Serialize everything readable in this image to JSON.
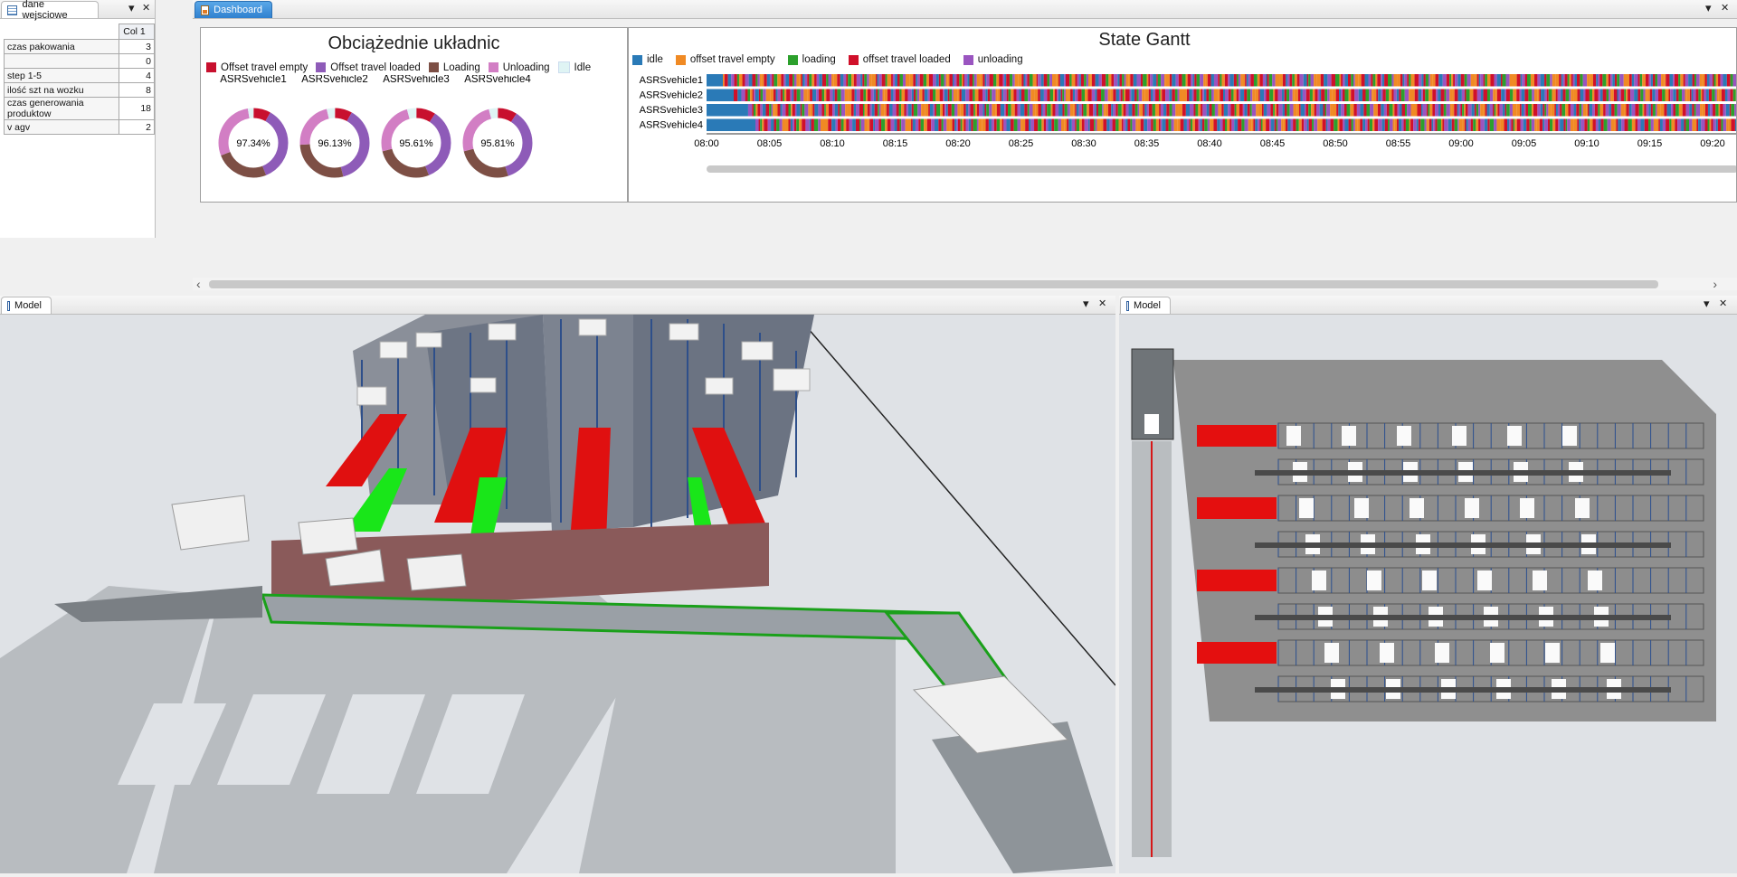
{
  "left_pane": {
    "tab_label": "dane wejsciowe",
    "column_header": "Col 1",
    "rows": [
      {
        "label": "czas pakowania",
        "value": "3"
      },
      {
        "label": "",
        "value": "0"
      },
      {
        "label": "step 1-5",
        "value": "4"
      },
      {
        "label": "ilość szt na wozku",
        "value": "8"
      },
      {
        "label": "czas generowania produktow",
        "value": "18"
      },
      {
        "label": "v agv",
        "value": "2"
      }
    ]
  },
  "dashboard": {
    "tab_label": "Dashboard",
    "utilization": {
      "title": "Obciążednie układnic",
      "legend": [
        {
          "label": "Offset travel empty",
          "color": "#c8102e"
        },
        {
          "label": "Offset travel loaded",
          "color": "#8e5bb8"
        },
        {
          "label": "Loading",
          "color": "#7d4f45"
        },
        {
          "label": "Unloading",
          "color": "#d27ec4"
        },
        {
          "label": "Idle",
          "color": "#dff4f4"
        }
      ]
    },
    "gantt": {
      "title": "State Gantt",
      "legend": [
        {
          "label": "idle",
          "color": "#2a7ab7"
        },
        {
          "label": "offset travel empty",
          "color": "#f08a24"
        },
        {
          "label": "loading",
          "color": "#2ca02c"
        },
        {
          "label": "offset travel loaded",
          "color": "#d0102a"
        },
        {
          "label": "unloading",
          "color": "#9a55c0"
        }
      ],
      "rows": [
        "ASRSvehicle1",
        "ASRSvehicle2",
        "ASRSvehicle3",
        "ASRSvehicle4"
      ],
      "time_ticks": [
        "08:00",
        "08:05",
        "08:10",
        "08:15",
        "08:20",
        "08:25",
        "08:30",
        "08:35",
        "08:40",
        "08:45",
        "08:50",
        "08:55",
        "09:00",
        "09:05",
        "09:10",
        "09:15",
        "09:20"
      ]
    }
  },
  "chart_data": {
    "type": "pie",
    "title": "Obciążednie układnic",
    "legend_position": "top",
    "categories": [
      "Offset travel empty",
      "Offset travel loaded",
      "Loading",
      "Unloading",
      "Idle"
    ],
    "series": [
      {
        "name": "ASRSvehicle1",
        "label": "97.34%",
        "values": [
          8,
          36,
          25,
          28.34,
          2.66
        ]
      },
      {
        "name": "ASRSvehicle2",
        "label": "96.13%",
        "values": [
          8,
          38,
          28,
          22.13,
          3.87
        ]
      },
      {
        "name": "ASRSvehicle3",
        "label": "95.61%",
        "values": [
          9,
          35,
          27,
          24.61,
          4.39
        ]
      },
      {
        "name": "ASRSvehicle4",
        "label": "95.81%",
        "values": [
          9,
          36,
          26,
          24.81,
          4.19
        ]
      }
    ]
  },
  "model_left": {
    "tab_label": "Model"
  },
  "model_right": {
    "tab_label": "Model"
  },
  "controls": {
    "dropdown": "▾",
    "close": "✕",
    "scroll_left": "‹",
    "scroll_right": "›"
  }
}
